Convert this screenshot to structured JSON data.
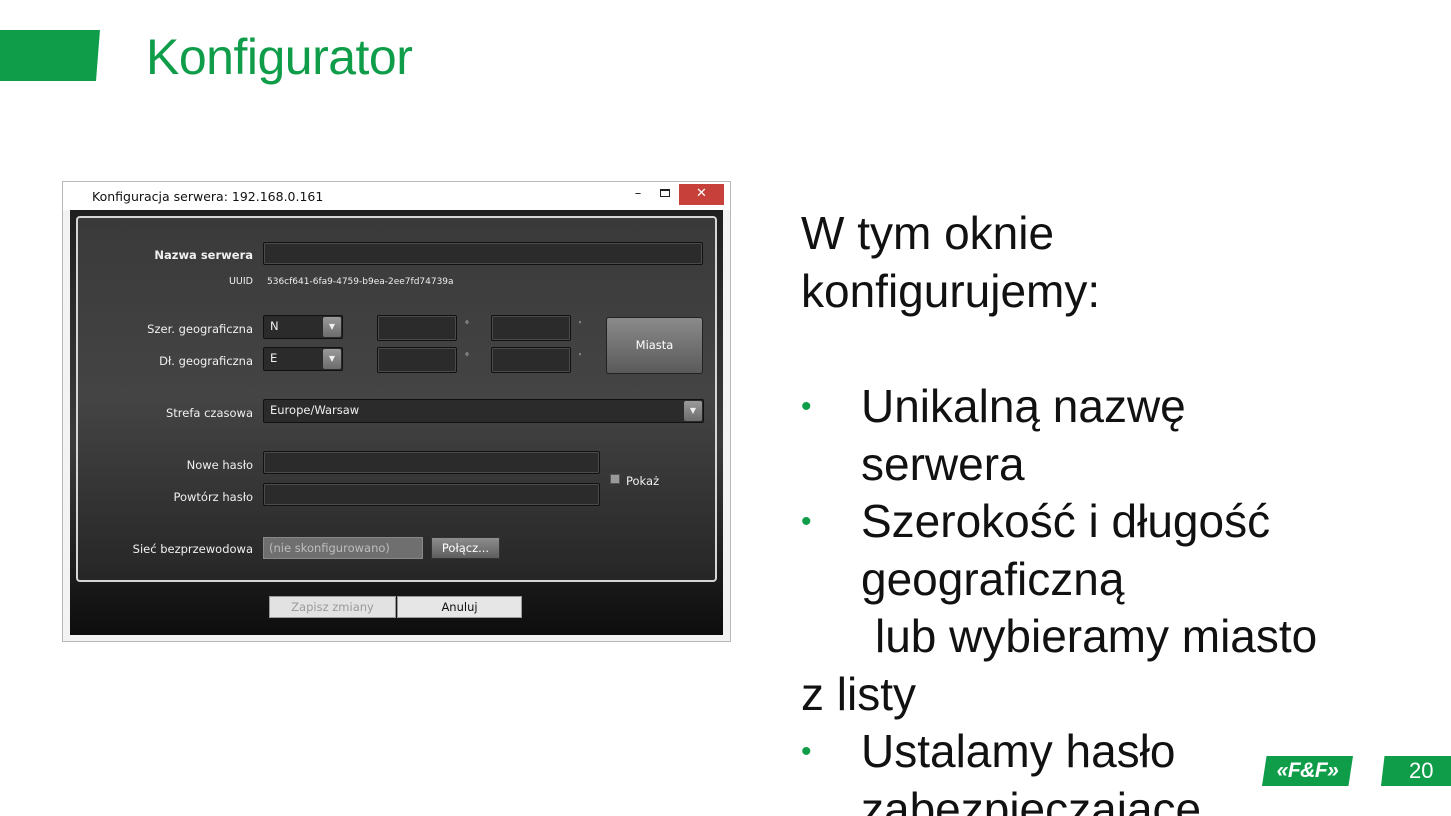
{
  "slide": {
    "title": "Konfigurator",
    "page_number": "20",
    "logo_text": "«F&F»"
  },
  "window": {
    "title": "Konfiguracja serwera: 192.168.0.161",
    "controls": {
      "minimize": "–",
      "close": "✕"
    },
    "form": {
      "server_name_label": "Nazwa serwera",
      "server_name_value": "",
      "uuid_label": "UUID",
      "uuid_value": "536cf641-6fa9-4759-b9ea-2ee7fd74739a",
      "latitude_label": "Szer. geograficzna",
      "latitude_hemisphere": "N",
      "longitude_label": "Dł. geograficzna",
      "longitude_hemisphere": "E",
      "degree_symbol": "°",
      "minute_symbol": "'",
      "cities_button": "Miasta",
      "timezone_label": "Strefa czasowa",
      "timezone_value": "Europe/Warsaw",
      "new_password_label": "Nowe hasło",
      "repeat_password_label": "Powtórz hasło",
      "show_label": "Pokaż",
      "wifi_label": "Sieć bezprzewodowa",
      "wifi_value": "(nie skonfigurowano)",
      "connect_button": "Połącz...",
      "save_button": "Zapisz zmiany",
      "cancel_button": "Anuluj"
    }
  },
  "body_text": {
    "intro_line1": "W tym oknie",
    "intro_line2": "konfigurujemy:",
    "bullets": [
      {
        "line1": "Unikalną nazwę",
        "line2": "serwera"
      },
      {
        "line1": "Szerokość i długość",
        "line2": "geograficzną"
      },
      {
        "line1": "Ustalamy hasło",
        "line2": "zabezpieczające"
      }
    ],
    "extra_line1": "lub wybieramy miasto",
    "extra_line2": "z listy",
    "bullet_symbol": "•"
  },
  "colors": {
    "brand_green": "#0f9d4a",
    "close_red": "#c7413a"
  }
}
